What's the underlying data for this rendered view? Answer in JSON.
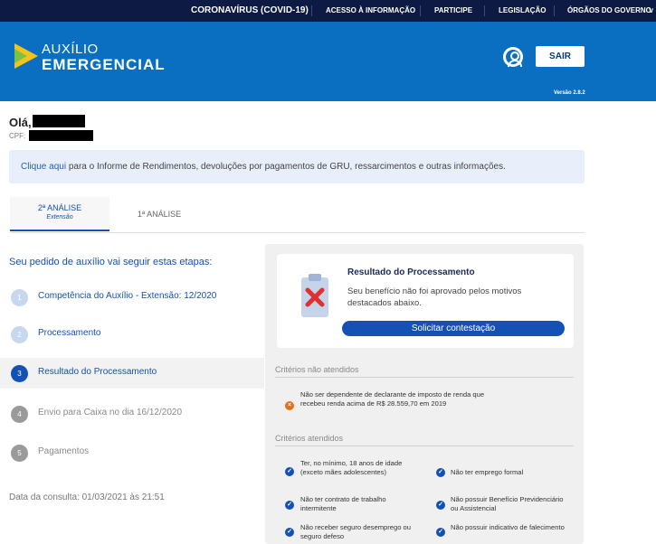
{
  "govbar": {
    "covid": "CORONAVÍRUS (COVID-19)",
    "acesso": "ACESSO À INFORMAÇÃO",
    "participe": "PARTICIPE",
    "legislacao": "LEGISLAÇÃO",
    "orgaos": "ÓRGÃOS DO GOVERNO",
    "orgaos_chevron": "˅"
  },
  "header": {
    "logo_line1": "AUXÍLIO",
    "logo_line2": "EMERGENCIAL",
    "logout_label": "SAIR",
    "version": "Versão 2.8.2"
  },
  "user": {
    "greeting": "Olá,",
    "cpf_label": "CPF:"
  },
  "info": {
    "link": "Clique aqui",
    "text": " para o Informe de Rendimentos, devoluções por pagamentos de GRU, ressarcimentos e outras informações."
  },
  "tabs": [
    {
      "label": "2ª ANÁLISE",
      "sub": "Extensão",
      "active": true
    },
    {
      "label": "1ª ANÁLISE",
      "sub": "",
      "active": false
    }
  ],
  "steps": {
    "title": "Seu pedido de auxílio vai seguir estas etapas:",
    "items": [
      {
        "num": "1",
        "label": "Competência do Auxílio - Extensão: 12/2020"
      },
      {
        "num": "2",
        "label": "Processamento"
      },
      {
        "num": "3",
        "label": "Resultado do Processamento"
      },
      {
        "num": "4",
        "label": "Envio para Caixa no dia 16/12/2020"
      },
      {
        "num": "5",
        "label": "Pagamentos"
      }
    ],
    "consulta": "Data da consulta: 01/03/2021 às 21:51"
  },
  "result": {
    "title": "Resultado do Processamento",
    "text": "Seu benefício não foi aprovado pelos motivos destacados abaixo.",
    "button": "Solicitar contestação"
  },
  "criteria": {
    "not_met_title": "Critérios não atendidos",
    "not_met": [
      "Não ser dependente de declarante de imposto de renda que recebeu renda acima de R$ 28.559,70 em 2019"
    ],
    "met_title": "Critérios atendidos",
    "met": [
      "Ter, no mínimo, 18 anos de idade (exceto mães adolescentes)",
      "Não ter emprego formal",
      "Não ter contrato de trabalho intermitente",
      "Não possuir Benefício Previdenciário ou Assistencial",
      "Não receber seguro desemprego ou seguro defeso",
      "Não possuir indicativo de falecimento"
    ]
  },
  "colors": {
    "govbar": "#0d1a44",
    "header": "#0a6fc0",
    "primary": "#1351b4",
    "warning": "#e0701a"
  }
}
